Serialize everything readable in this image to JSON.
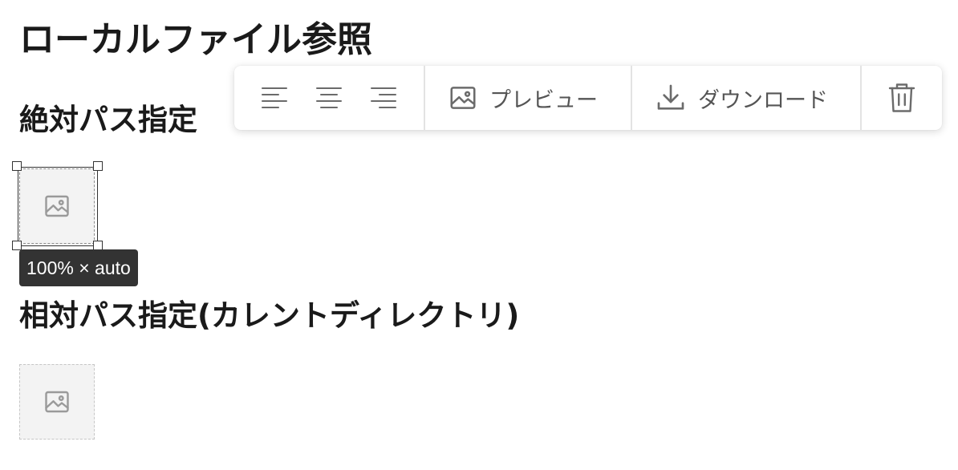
{
  "page": {
    "title": "ローカルファイル参照",
    "sections": [
      {
        "heading": "絶対パス指定"
      },
      {
        "heading": "相対パス指定(カレントディレクトリ)"
      }
    ]
  },
  "toolbar": {
    "align_left_icon": "align-left-icon",
    "align_center_icon": "align-center-icon",
    "align_right_icon": "align-right-icon",
    "preview_icon": "image-icon",
    "preview_label": "プレビュー",
    "download_icon": "download-icon",
    "download_label": "ダウンロード",
    "delete_icon": "trash-icon"
  },
  "selected_image": {
    "size_label": "100% × auto"
  },
  "colors": {
    "toolbar_icon": "#6b6b6b",
    "placeholder_bg": "#f3f3f3",
    "tooltip_bg": "#333333"
  }
}
